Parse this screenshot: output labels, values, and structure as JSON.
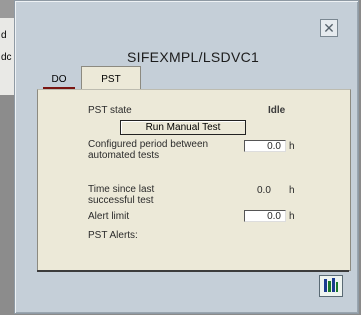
{
  "background": {
    "labels": [
      "d",
      "dc"
    ]
  },
  "window": {
    "title": "SIFEXMPL/LSDVC1",
    "tabs": [
      {
        "label": "DO",
        "active": false
      },
      {
        "label": "PST",
        "active": true
      }
    ]
  },
  "pst": {
    "state_label": "PST state",
    "state_value": "Idle",
    "run_button_label": "Run Manual Test",
    "configured_label_line1": "Configured period between",
    "configured_label_line2": "automated tests",
    "configured_value": "0.0",
    "configured_unit": "h",
    "since_label_line1": "Time since last",
    "since_label_line2": "successful test",
    "since_value": "0.0",
    "since_unit": "h",
    "alert_label": "Alert limit",
    "alert_value": "0.0",
    "alert_unit": "h",
    "alerts_label": "PST Alerts:"
  },
  "colors": {
    "face": "#c5cfd8",
    "panel": "#ece9d8",
    "tab_underline": "#7a1512"
  },
  "icons": {
    "close": "close-icon",
    "faceplate": "faceplate-icon"
  }
}
